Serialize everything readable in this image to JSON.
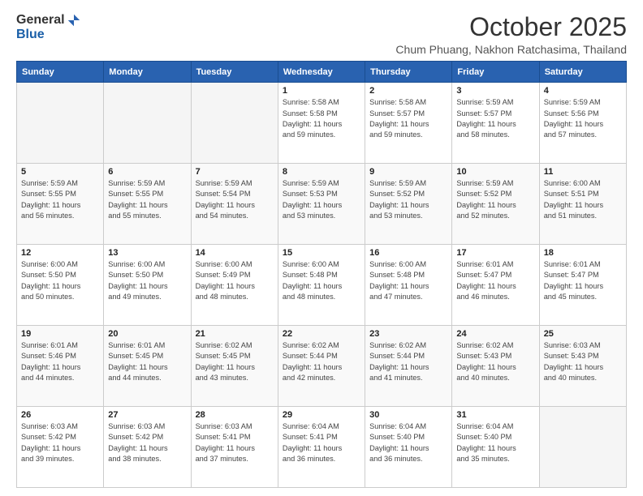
{
  "logo": {
    "general": "General",
    "blue": "Blue"
  },
  "title": {
    "month_year": "October 2025",
    "location": "Chum Phuang, Nakhon Ratchasima, Thailand"
  },
  "days_of_week": [
    "Sunday",
    "Monday",
    "Tuesday",
    "Wednesday",
    "Thursday",
    "Friday",
    "Saturday"
  ],
  "weeks": [
    [
      {
        "day": "",
        "info": ""
      },
      {
        "day": "",
        "info": ""
      },
      {
        "day": "",
        "info": ""
      },
      {
        "day": "1",
        "info": "Sunrise: 5:58 AM\nSunset: 5:58 PM\nDaylight: 11 hours\nand 59 minutes."
      },
      {
        "day": "2",
        "info": "Sunrise: 5:58 AM\nSunset: 5:57 PM\nDaylight: 11 hours\nand 59 minutes."
      },
      {
        "day": "3",
        "info": "Sunrise: 5:59 AM\nSunset: 5:57 PM\nDaylight: 11 hours\nand 58 minutes."
      },
      {
        "day": "4",
        "info": "Sunrise: 5:59 AM\nSunset: 5:56 PM\nDaylight: 11 hours\nand 57 minutes."
      }
    ],
    [
      {
        "day": "5",
        "info": "Sunrise: 5:59 AM\nSunset: 5:55 PM\nDaylight: 11 hours\nand 56 minutes."
      },
      {
        "day": "6",
        "info": "Sunrise: 5:59 AM\nSunset: 5:55 PM\nDaylight: 11 hours\nand 55 minutes."
      },
      {
        "day": "7",
        "info": "Sunrise: 5:59 AM\nSunset: 5:54 PM\nDaylight: 11 hours\nand 54 minutes."
      },
      {
        "day": "8",
        "info": "Sunrise: 5:59 AM\nSunset: 5:53 PM\nDaylight: 11 hours\nand 53 minutes."
      },
      {
        "day": "9",
        "info": "Sunrise: 5:59 AM\nSunset: 5:52 PM\nDaylight: 11 hours\nand 53 minutes."
      },
      {
        "day": "10",
        "info": "Sunrise: 5:59 AM\nSunset: 5:52 PM\nDaylight: 11 hours\nand 52 minutes."
      },
      {
        "day": "11",
        "info": "Sunrise: 6:00 AM\nSunset: 5:51 PM\nDaylight: 11 hours\nand 51 minutes."
      }
    ],
    [
      {
        "day": "12",
        "info": "Sunrise: 6:00 AM\nSunset: 5:50 PM\nDaylight: 11 hours\nand 50 minutes."
      },
      {
        "day": "13",
        "info": "Sunrise: 6:00 AM\nSunset: 5:50 PM\nDaylight: 11 hours\nand 49 minutes."
      },
      {
        "day": "14",
        "info": "Sunrise: 6:00 AM\nSunset: 5:49 PM\nDaylight: 11 hours\nand 48 minutes."
      },
      {
        "day": "15",
        "info": "Sunrise: 6:00 AM\nSunset: 5:48 PM\nDaylight: 11 hours\nand 48 minutes."
      },
      {
        "day": "16",
        "info": "Sunrise: 6:00 AM\nSunset: 5:48 PM\nDaylight: 11 hours\nand 47 minutes."
      },
      {
        "day": "17",
        "info": "Sunrise: 6:01 AM\nSunset: 5:47 PM\nDaylight: 11 hours\nand 46 minutes."
      },
      {
        "day": "18",
        "info": "Sunrise: 6:01 AM\nSunset: 5:47 PM\nDaylight: 11 hours\nand 45 minutes."
      }
    ],
    [
      {
        "day": "19",
        "info": "Sunrise: 6:01 AM\nSunset: 5:46 PM\nDaylight: 11 hours\nand 44 minutes."
      },
      {
        "day": "20",
        "info": "Sunrise: 6:01 AM\nSunset: 5:45 PM\nDaylight: 11 hours\nand 44 minutes."
      },
      {
        "day": "21",
        "info": "Sunrise: 6:02 AM\nSunset: 5:45 PM\nDaylight: 11 hours\nand 43 minutes."
      },
      {
        "day": "22",
        "info": "Sunrise: 6:02 AM\nSunset: 5:44 PM\nDaylight: 11 hours\nand 42 minutes."
      },
      {
        "day": "23",
        "info": "Sunrise: 6:02 AM\nSunset: 5:44 PM\nDaylight: 11 hours\nand 41 minutes."
      },
      {
        "day": "24",
        "info": "Sunrise: 6:02 AM\nSunset: 5:43 PM\nDaylight: 11 hours\nand 40 minutes."
      },
      {
        "day": "25",
        "info": "Sunrise: 6:03 AM\nSunset: 5:43 PM\nDaylight: 11 hours\nand 40 minutes."
      }
    ],
    [
      {
        "day": "26",
        "info": "Sunrise: 6:03 AM\nSunset: 5:42 PM\nDaylight: 11 hours\nand 39 minutes."
      },
      {
        "day": "27",
        "info": "Sunrise: 6:03 AM\nSunset: 5:42 PM\nDaylight: 11 hours\nand 38 minutes."
      },
      {
        "day": "28",
        "info": "Sunrise: 6:03 AM\nSunset: 5:41 PM\nDaylight: 11 hours\nand 37 minutes."
      },
      {
        "day": "29",
        "info": "Sunrise: 6:04 AM\nSunset: 5:41 PM\nDaylight: 11 hours\nand 36 minutes."
      },
      {
        "day": "30",
        "info": "Sunrise: 6:04 AM\nSunset: 5:40 PM\nDaylight: 11 hours\nand 36 minutes."
      },
      {
        "day": "31",
        "info": "Sunrise: 6:04 AM\nSunset: 5:40 PM\nDaylight: 11 hours\nand 35 minutes."
      },
      {
        "day": "",
        "info": ""
      }
    ]
  ]
}
